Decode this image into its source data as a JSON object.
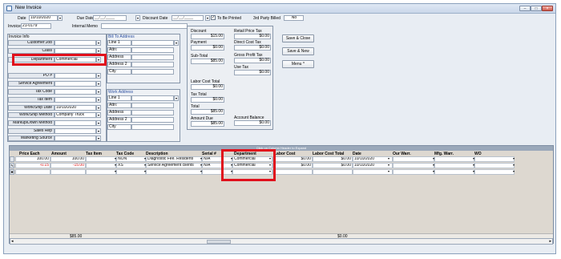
{
  "window": {
    "title": "New Invoice"
  },
  "header": {
    "date_label": "Date",
    "date_value": "10/10/2020",
    "due_label": "Due Date",
    "due_value": "__/__/____",
    "discount_date_label": "Discount Date",
    "discount_date_value": "__/__/____",
    "to_be_printed_label": "To Be Printed",
    "to_be_printed_checked": true,
    "third_party_label": "3rd Party Billed",
    "third_party_value": "No",
    "invoice_label": "Invoice #",
    "invoice_value": "21-0179",
    "internal_memo_label": "Internal Memo"
  },
  "invoice_info": {
    "title": "Invoice Info",
    "rows": [
      {
        "label": "Customer:Job",
        "value": ""
      },
      {
        "label": "Class",
        "value": ""
      },
      {
        "label": "Department",
        "value": "Commercial"
      },
      {
        "label": "PO #",
        "value": ""
      },
      {
        "label": "Service Agreement",
        "value": ""
      },
      {
        "label": "Tax Code",
        "value": ""
      },
      {
        "label": "Tax Item",
        "value": ""
      },
      {
        "label": "Work/Ship Date",
        "value": "10/10/2020"
      },
      {
        "label": "Work/Ship Method",
        "value": "Company Truck"
      },
      {
        "label": "Markup/Down Method",
        "value": ""
      },
      {
        "label": "Sales Rep",
        "value": ""
      },
      {
        "label": "Marketing Source",
        "value": ""
      }
    ]
  },
  "bill_to": {
    "title": "Bill To Address",
    "rows": [
      "Line 1",
      "Attn:",
      "Address",
      "Address 2",
      "City"
    ]
  },
  "work_address": {
    "title": "Work Address",
    "rows": [
      "Line 1",
      "Attn:",
      "Address",
      "Address 2",
      "City"
    ]
  },
  "summary": {
    "discount": {
      "label": "Discount",
      "value": "$15.00"
    },
    "payment": {
      "label": "Payment",
      "value": "$0.00"
    },
    "subtotal": {
      "label": "Sub-Total",
      "value": "$85.00"
    },
    "labor_cost_total": {
      "label": "Labor Cost Total",
      "value": "$0.00"
    },
    "tax_total": {
      "label": "Tax Total",
      "value": "$0.00"
    },
    "total": {
      "label": "Total",
      "value": "$85.00"
    },
    "amount_due": {
      "label": "Amount Due",
      "value": "$85.00"
    },
    "retail_price_tax": {
      "label": "Retail Price Tax",
      "value": "$0.00"
    },
    "direct_cost_tax": {
      "label": "Direct Cost Tax",
      "value": "$0.00"
    },
    "gross_profit_tax": {
      "label": "Gross Profit Tax",
      "value": "$0.00"
    },
    "use_tax": {
      "label": "Use Tax",
      "value": "$0.00"
    },
    "account_balance": {
      "label": "Account Balance",
      "value": "$0.00"
    }
  },
  "actions": {
    "save_close": "Save & Close",
    "save_new": "Save & New",
    "menu": "Menu ^"
  },
  "grid": {
    "hint": "Click on Column Header to Expand",
    "columns": [
      "Price Each",
      "Amount",
      "Tax Item",
      "Tax Code",
      "Description",
      "Serial #",
      "Department",
      "Labor Cost",
      "Labor Cost Total",
      "Date",
      "Our Warr.",
      "Mfg. Warr.",
      "WO"
    ],
    "rows": [
      {
        "price": "100.00",
        "amount": "100.00",
        "tax_code": "NON",
        "description": "Diagnostic Fee. Residenti",
        "serial": "N/A",
        "department": "Commercial",
        "labor_cost": "$0.00",
        "labor_total": "$0.00",
        "date": "10/10/2020"
      },
      {
        "price": "-0.15",
        "amount": "-15.00",
        "tax_code": "XS",
        "description": "Service Agreement clients",
        "serial": "N/A",
        "department": "Commercial",
        "labor_cost": "$0.00",
        "labor_total": "$0.00",
        "date": "10/10/2020"
      }
    ],
    "totals": {
      "amount": "$85.00",
      "labor_total": "$0.00"
    }
  },
  "colors": {
    "highlight": "#e0101c",
    "negative": "#e01010"
  }
}
